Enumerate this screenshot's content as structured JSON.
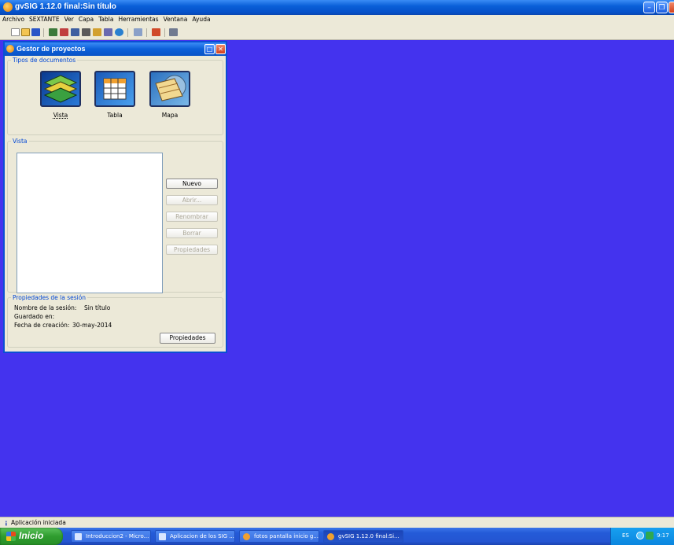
{
  "app": {
    "title": "gvSIG 1.12.0 final:Sin título"
  },
  "menu": [
    "Archivo",
    "SEXTANTE",
    "Ver",
    "Capa",
    "Tabla",
    "Herramientas",
    "Ventana",
    "Ayuda"
  ],
  "project_manager": {
    "title": "Gestor de proyectos",
    "doc_types_legend": "Tipos de documentos",
    "doc_types": [
      {
        "label": "Vista",
        "icon": "vista-layers-icon"
      },
      {
        "label": "Tabla",
        "icon": "tabla-grid-icon"
      },
      {
        "label": "Mapa",
        "icon": "mapa-icon"
      }
    ],
    "list_legend": "Vista",
    "buttons": {
      "nuevo": "Nuevo",
      "abrir": "Abrir...",
      "renombrar": "Renombrar",
      "borrar": "Borrar",
      "propiedades": "Propiedades"
    },
    "session": {
      "legend": "Propiedades de la sesión",
      "name_label": "Nombre de la sesión:",
      "name_value": "Sin título",
      "saved_label": "Guardado en:",
      "saved_value": "",
      "date_label": "Fecha de creación:",
      "date_value": "30-may-2014",
      "properties_button": "Propiedades"
    }
  },
  "status": {
    "text": "Aplicación iniciada"
  },
  "taskbar": {
    "start_label": "Inicio",
    "tasks": [
      "Introduccion2 - Micro...",
      "Aplicacion de los SIG ...",
      "fotos pantalla inicio g...",
      "gvSIG 1.12.0 final:Si..."
    ],
    "tray": {
      "lang": "ES",
      "clock": "9:17"
    }
  }
}
